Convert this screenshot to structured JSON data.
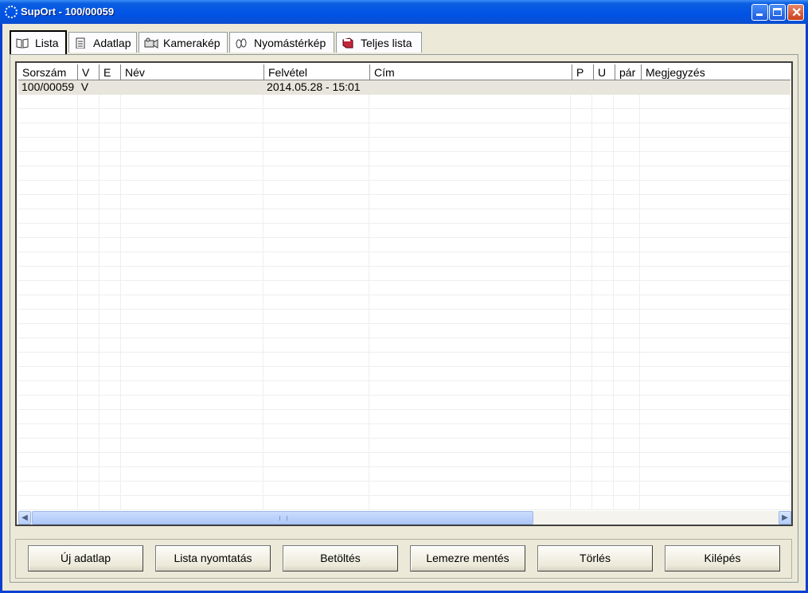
{
  "window": {
    "title": "SupOrt - 100/00059"
  },
  "tabs": [
    {
      "label": "Lista",
      "icon": "book-icon"
    },
    {
      "label": "Adatlap",
      "icon": "clipboard-icon"
    },
    {
      "label": "Kamerakép",
      "icon": "camera-icon"
    },
    {
      "label": "Nyomástérkép",
      "icon": "footprint-icon"
    },
    {
      "label": "Teljes lista",
      "icon": "red-book-icon"
    }
  ],
  "grid": {
    "columns": [
      "Sorszám",
      "V",
      "E",
      "Név",
      "Felvétel",
      "Cím",
      "P",
      "U",
      "pár",
      "Megjegyzés"
    ],
    "rows": [
      [
        "100/00059",
        "V",
        "",
        "",
        "2014.05.28 - 15:01",
        "",
        "",
        "",
        "",
        ""
      ]
    ]
  },
  "buttons": {
    "new": "Új adatlap",
    "print": "Lista nyomtatás",
    "load": "Betöltés",
    "save": "Lemezre mentés",
    "delete": "Törlés",
    "exit": "Kilépés"
  },
  "colors": {
    "titlebar": "#0053e6",
    "face": "#ece9d8",
    "selected_row": "#e8e6dc"
  }
}
